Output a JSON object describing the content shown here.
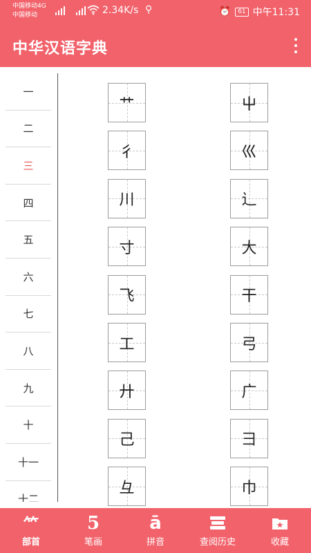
{
  "statusbar": {
    "carrier1": "中国移动4G",
    "carrier2": "中国移动",
    "speed": "2.34K/s",
    "battery": "61",
    "time": "中午11:31"
  },
  "appbar": {
    "title": "中华汉语字典"
  },
  "strokes": [
    "一",
    "二",
    "三",
    "四",
    "五",
    "六",
    "七",
    "八",
    "九",
    "十",
    "十一",
    "十二"
  ],
  "active_stroke": "三",
  "radicals_left": [
    "艹",
    "彳",
    "川",
    "寸",
    "飞",
    "工",
    "廾",
    "己",
    "彑"
  ],
  "radicals_right": [
    "屮",
    "巛",
    "辶",
    "大",
    "干",
    "弓",
    "广",
    "彐",
    "巾"
  ],
  "bottomnav": {
    "items": [
      {
        "label": "部首",
        "icon": "radical-icon"
      },
      {
        "label": "笔画",
        "icon": "stroke-five-icon"
      },
      {
        "label": "拼音",
        "icon": "pinyin-icon"
      },
      {
        "label": "查阅历史",
        "icon": "books-icon"
      },
      {
        "label": "收藏",
        "icon": "folder-star-icon"
      }
    ],
    "stroke_icon_text": "5",
    "pinyin_icon_text": "ā",
    "radical_icon_text": "⺮"
  },
  "colors": {
    "accent": "#f2626b",
    "active_text": "#e8534f"
  }
}
